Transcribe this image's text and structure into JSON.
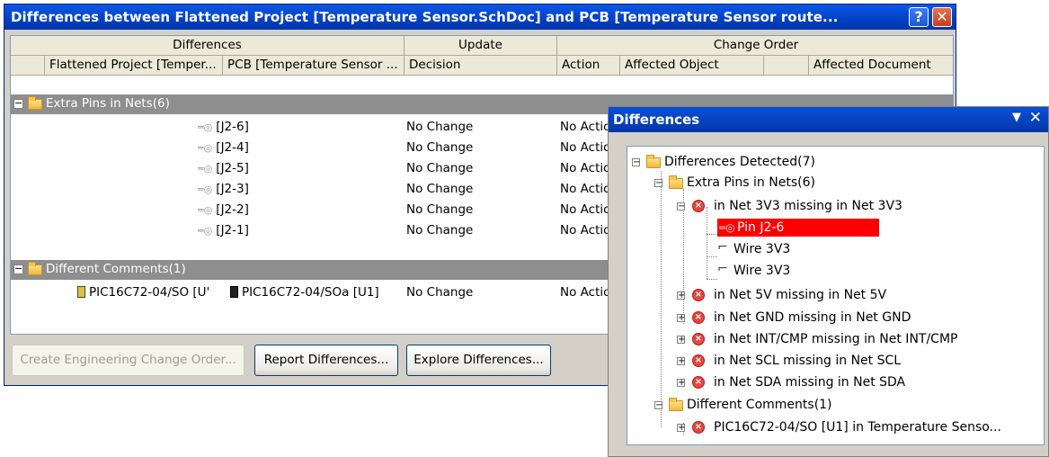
{
  "dialog": {
    "title": "Differences between Flattened Project [Temperature Sensor.SchDoc] and PCB [Temperature Sensor route...",
    "help_glyph": "?",
    "close_glyph": "✕",
    "header_groups": [
      "Differences",
      "Update",
      "Change Order"
    ],
    "columns": [
      "Flattened Project [Temper...",
      "PCB [Temperature Sensor ...",
      "Decision",
      "Action",
      "Affected Object",
      "Affected Document"
    ],
    "groups": [
      {
        "label": "Extra Pins in Nets(6)",
        "rows": [
          {
            "pcb": "[J2-6]",
            "decision": "No Change",
            "action": "No Actio"
          },
          {
            "pcb": "[J2-4]",
            "decision": "No Change",
            "action": "No Actio"
          },
          {
            "pcb": "[J2-5]",
            "decision": "No Change",
            "action": "No Actio"
          },
          {
            "pcb": "[J2-3]",
            "decision": "No Change",
            "action": "No Actio"
          },
          {
            "pcb": "[J2-2]",
            "decision": "No Change",
            "action": "No Actio"
          },
          {
            "pcb": "[J2-1]",
            "decision": "No Change",
            "action": "No Actio"
          }
        ]
      },
      {
        "label": "Different Comments(1)",
        "rows": [
          {
            "flat": "PIC16C72-04/SO [U'",
            "pcb": "PIC16C72-04/SOa [U1]",
            "decision": "No Change",
            "action": "No Actio"
          }
        ]
      }
    ],
    "buttons": {
      "create_eco": "Create Engineering Change Order...",
      "report": "Report Differences...",
      "explore": "Explore Differences..."
    }
  },
  "panel": {
    "title": "Differences",
    "menu_glyph": "▼",
    "close_glyph": "✕",
    "tree": {
      "root": "Differences Detected(7)",
      "extra_pins": "Extra Pins in Nets(6)",
      "net_3v3": "in Net 3V3 missing in Net 3V3",
      "pin_selected": "Pin J2-6",
      "wire_1": "Wire 3V3",
      "wire_2": "Wire 3V3",
      "net_5v": "in Net 5V missing in Net 5V",
      "net_gnd": "in Net GND missing in Net GND",
      "net_int": "in Net INT/CMP missing in Net INT/CMP",
      "net_scl": "in Net SCL missing in Net SCL",
      "net_sda": "in Net SDA missing in Net SDA",
      "diff_comments": "Different Comments(1)",
      "pic": "PIC16C72-04/SO [U1] in Temperature Senso..."
    }
  },
  "icons": {
    "pin": "pin-icon",
    "chip": "component-icon",
    "folder": "folder-icon",
    "error": "error-icon",
    "wire": "wire-icon"
  },
  "colors": {
    "title_bar": "#0340c4",
    "group_row": "#8e8e8e",
    "selection": "#ff0000",
    "dialog_face": "#d4d0c8"
  }
}
